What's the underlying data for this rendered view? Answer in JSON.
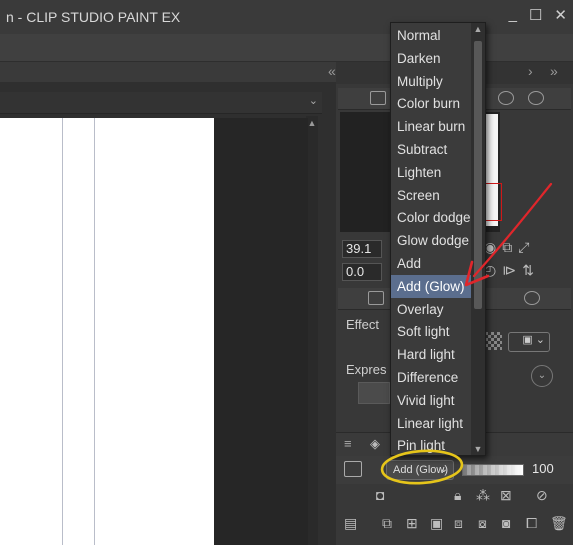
{
  "window": {
    "title": "n - CLIP STUDIO PAINT EX",
    "minimize_glyph": "_",
    "maximize_glyph": "☐",
    "close_glyph": "✕"
  },
  "right_panel": {
    "toprow_left_glyph": "«",
    "toprow_right_glyph": "›",
    "toprow_far_right_glyph": "»",
    "navigator": {
      "zoom_value": "39.1",
      "rotation_value": "0.0"
    },
    "properties": {
      "effect_label": "Effect",
      "expression_label": "Expres"
    },
    "layer": {
      "blend_mode_value": "Add (Glow)",
      "opacity_value": "100"
    }
  },
  "blend_dropdown": {
    "items": [
      "Normal",
      "Darken",
      "Multiply",
      "Color burn",
      "Linear burn",
      "Subtract",
      "Lighten",
      "Screen",
      "Color dodge",
      "Glow dodge",
      "Add",
      "Add (Glow)",
      "Overlay",
      "Soft light",
      "Hard light",
      "Difference",
      "Vivid light",
      "Linear light",
      "Pin light"
    ],
    "selected": "Add (Glow)"
  },
  "annotation_colors": {
    "arrow": "#e0262b",
    "circle": "#e6c51a"
  }
}
